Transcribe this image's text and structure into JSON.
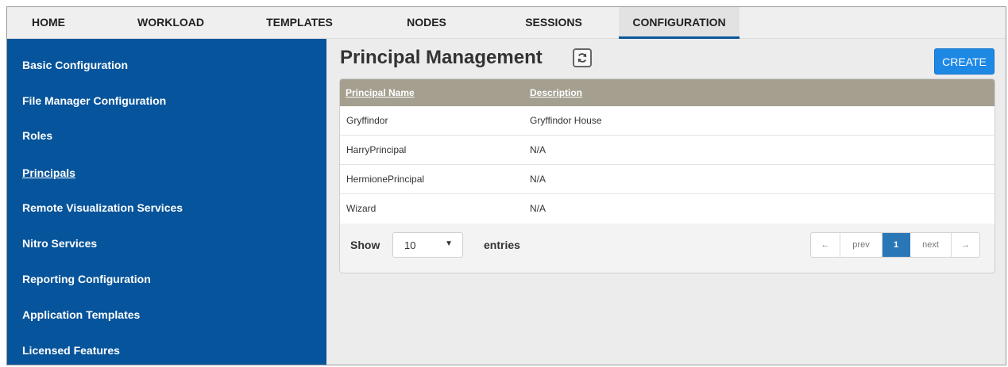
{
  "topnav": {
    "items": [
      {
        "label": "HOME"
      },
      {
        "label": "WORKLOAD"
      },
      {
        "label": "TEMPLATES"
      },
      {
        "label": "NODES"
      },
      {
        "label": "SESSIONS"
      },
      {
        "label": "CONFIGURATION"
      }
    ],
    "active": "CONFIGURATION"
  },
  "sidebar": {
    "items": [
      {
        "label": "Basic Configuration"
      },
      {
        "label": "File Manager Configuration"
      },
      {
        "label": "Roles"
      },
      {
        "label": "Principals"
      },
      {
        "label": "Remote Visualization Services"
      },
      {
        "label": "Nitro Services"
      },
      {
        "label": "Reporting Configuration"
      },
      {
        "label": "Application Templates"
      },
      {
        "label": "Licensed Features"
      }
    ],
    "active": "Principals",
    "background": "#06549b"
  },
  "main": {
    "title": "Principal Management",
    "refresh_icon": "refresh-icon",
    "create_label": "CREATE",
    "accent": "#1e88e5"
  },
  "table": {
    "columns": [
      "Principal Name",
      "Description"
    ],
    "rows": [
      {
        "name": "Gryffindor",
        "description": "Gryffindor House"
      },
      {
        "name": "HarryPrincipal",
        "description": "N/A"
      },
      {
        "name": "HermionePrincipal",
        "description": "N/A"
      },
      {
        "name": "Wizard",
        "description": "N/A"
      }
    ],
    "header_color": "#a49f8f"
  },
  "footer": {
    "show_label": "Show",
    "page_size": "10",
    "entries_label": "entries"
  },
  "pagination": {
    "first": "←",
    "prev": "prev",
    "current": "1",
    "next": "next",
    "last": "→"
  }
}
